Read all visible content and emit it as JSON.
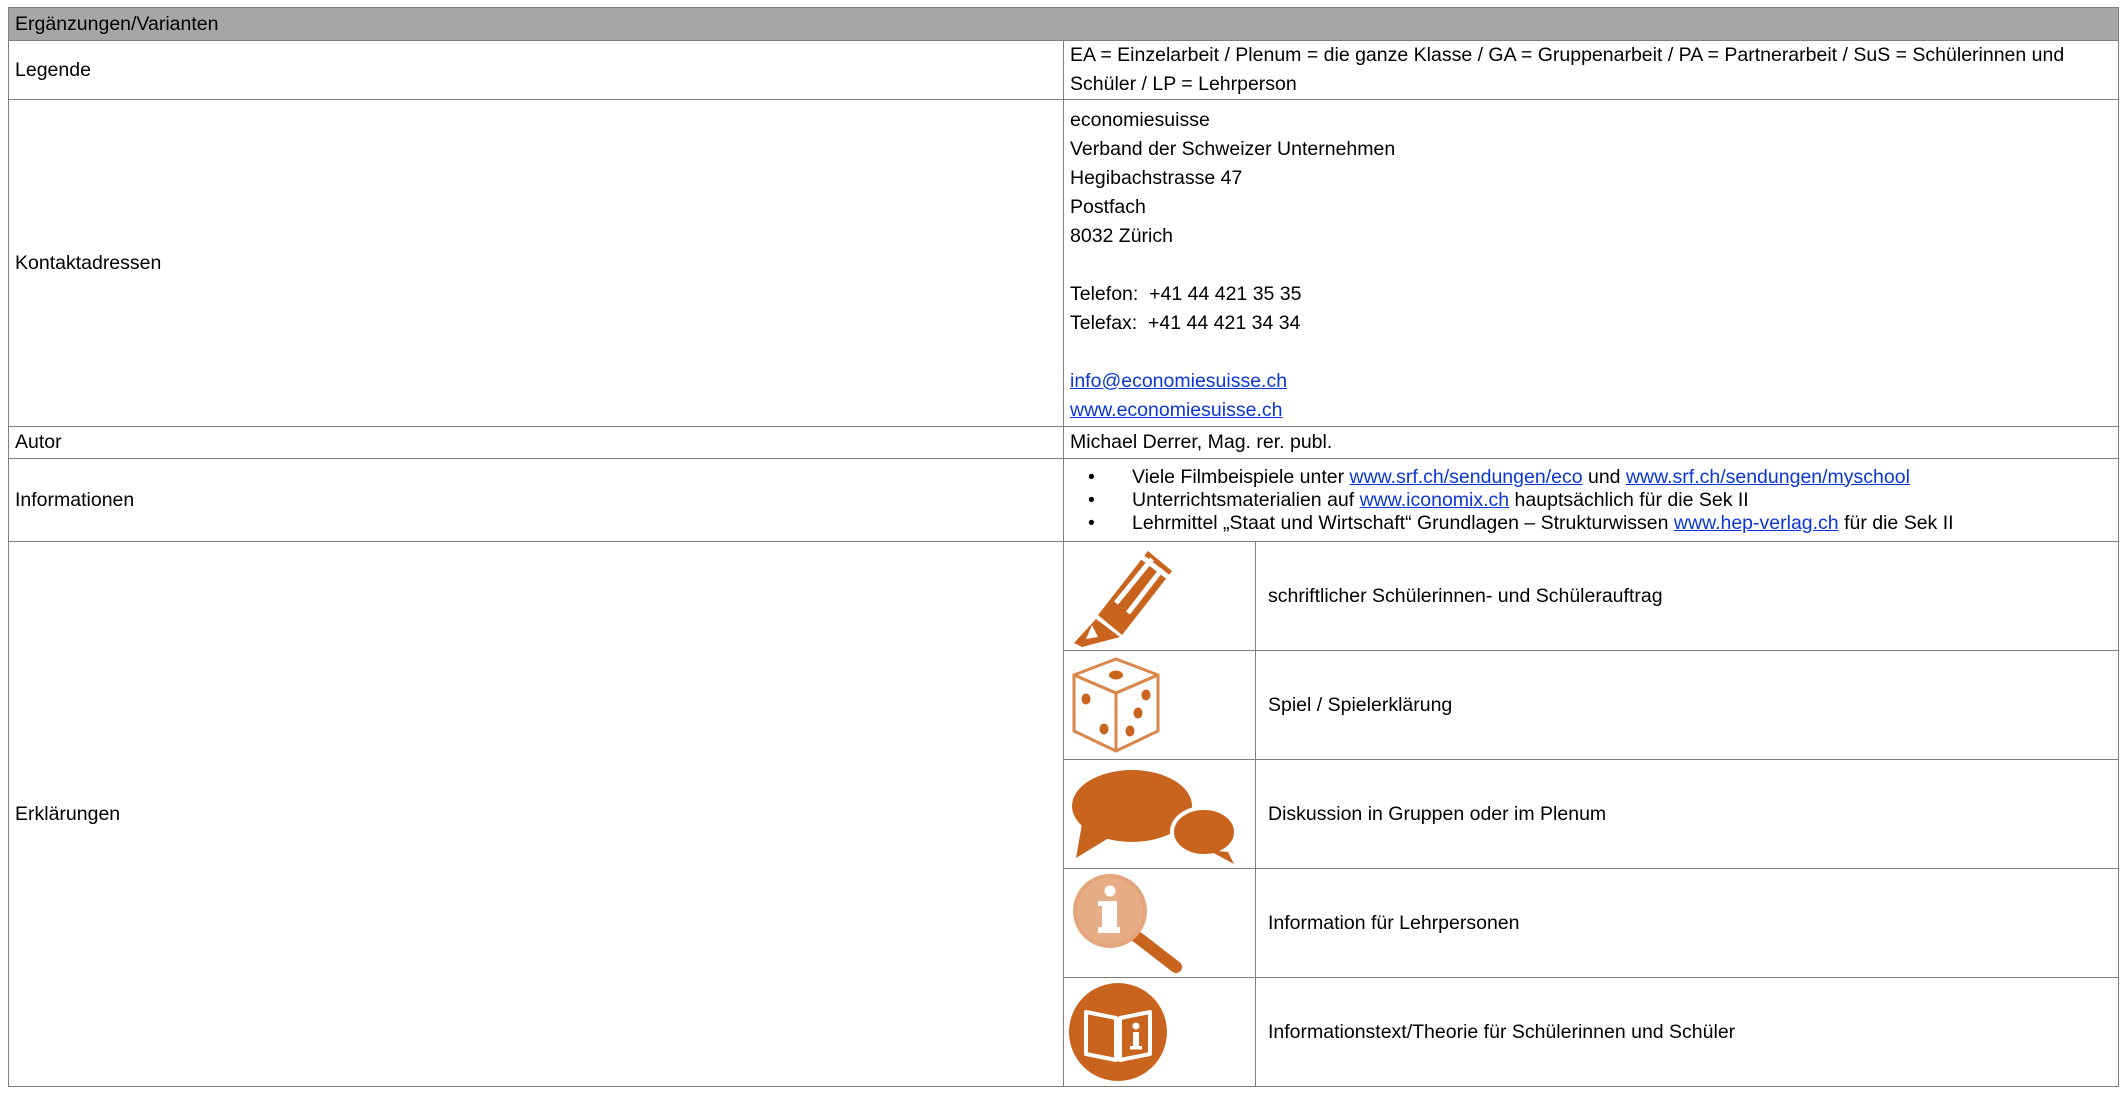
{
  "header": {
    "title": "Ergänzungen/Varianten"
  },
  "legende": {
    "label": "Legende",
    "text": "EA = Einzelarbeit / Plenum = die ganze Klasse / GA = Gruppenarbeit / PA = Partnerarbeit / SuS = Schülerinnen und Schüler / LP = Lehrperson"
  },
  "kontakt": {
    "label": "Kontaktadressen",
    "org": "economiesuisse",
    "line2": "Verband der Schweizer Unternehmen",
    "street": "Hegibachstrasse 47",
    "postfach": "Postfach",
    "city": "8032 Zürich",
    "telefon": "Telefon:  +41 44 421 35 35",
    "telefax": "Telefax:  +41 44 421 34 34",
    "email": "info@economiesuisse.ch",
    "web": "www.economiesuisse.ch"
  },
  "autor": {
    "label": "Autor",
    "text": "Michael Derrer, Mag. rer. publ."
  },
  "informationen": {
    "label": "Informationen",
    "bullet": "•",
    "item1": {
      "pre": "Viele Filmbeispiele unter ",
      "link1": "www.srf.ch/sendungen/eco",
      "mid": " und ",
      "link2": "www.srf.ch/sendungen/myschool"
    },
    "item2": {
      "pre": "Unterrichtsmaterialien auf ",
      "link": "www.iconomix.ch",
      "post": " hauptsächlich für die Sek II"
    },
    "item3": {
      "pre": "Lehrmittel „Staat und Wirtschaft“ Grundlagen – Strukturwissen ",
      "link": "www.hep-verlag.ch",
      "post": " für die Sek II"
    }
  },
  "erklaerungen": {
    "label": "Erklärungen",
    "accent": "#c8641e",
    "items": [
      {
        "icon": "pencil-icon",
        "text": "schriftlicher Schülerinnen- und Schülerauftrag"
      },
      {
        "icon": "dice-icon",
        "text": "Spiel / Spielerklärung"
      },
      {
        "icon": "speech-bubbles-icon",
        "text": "Diskussion in Gruppen oder im Plenum"
      },
      {
        "icon": "info-magnifier-icon",
        "text": "Information für Lehrpersonen"
      },
      {
        "icon": "book-info-icon",
        "text": "Informationstext/Theorie für Schülerinnen und Schüler"
      }
    ]
  }
}
